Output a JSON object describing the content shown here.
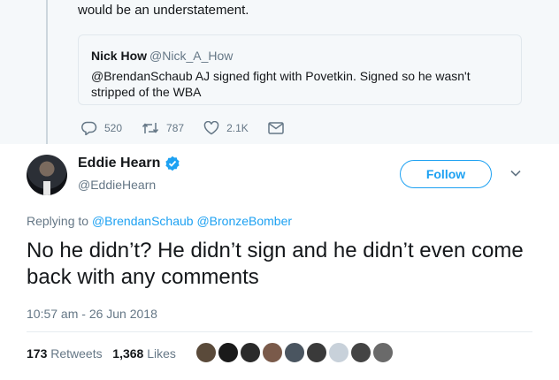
{
  "previous_tweet": {
    "text_tail": "would be an understatement.",
    "quote": {
      "name": "Nick How",
      "handle": "@Nick_A_How",
      "text": "@BrendanSchaub AJ signed fight with Povetkin. Signed so he wasn't stripped of the WBA"
    },
    "actions": {
      "replies": "520",
      "retweets": "787",
      "likes": "2.1K"
    }
  },
  "tweet": {
    "name": "Eddie Hearn",
    "handle": "@EddieHearn",
    "follow_label": "Follow",
    "replying_prefix": "Replying to",
    "replying_to": [
      "@BrendanSchaub",
      "@BronzeBomber"
    ],
    "text": "No he didn’t? He didn’t sign and he didn’t even come back with any comments",
    "timestamp": "10:57 am - 26 Jun 2018",
    "retweets_count": "173",
    "retweets_label": "Retweets",
    "likes_count": "1,368",
    "likes_label": "Likes"
  },
  "colors": {
    "accent": "#1da1f2",
    "secondary_text": "#657786",
    "thread_background": "#f5f8fa"
  }
}
